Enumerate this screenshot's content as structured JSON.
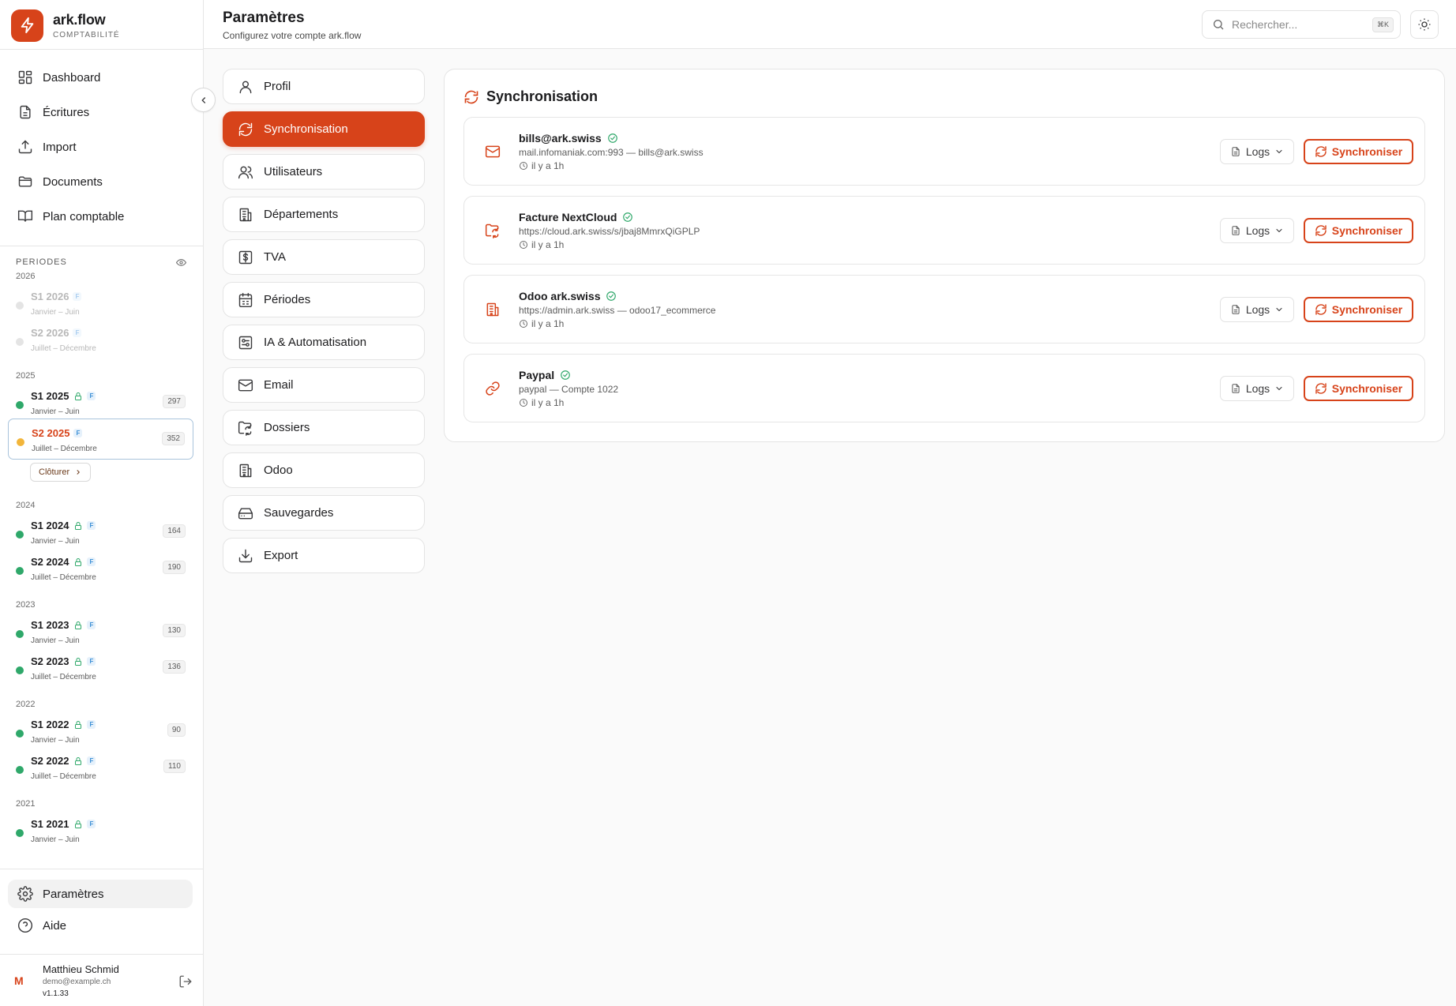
{
  "brand": {
    "name": "ark.flow",
    "subtitle": "COMPTABILITÉ"
  },
  "colors": {
    "accent": "#d7431a",
    "success": "#2fa86a",
    "warning": "#f2b53a",
    "muted": "#d6d6d6"
  },
  "nav": [
    {
      "label": "Dashboard",
      "icon": "dashboard-icon"
    },
    {
      "label": "Écritures",
      "icon": "document-icon"
    },
    {
      "label": "Import",
      "icon": "upload-icon"
    },
    {
      "label": "Documents",
      "icon": "folder-icon"
    },
    {
      "label": "Plan comptable",
      "icon": "book-icon"
    }
  ],
  "periods": {
    "title": "PERIODES",
    "groups": [
      {
        "year": "2026",
        "items": [
          {
            "name": "S1 2026",
            "tag": "F",
            "range": "Janvier – Juin",
            "status": "future",
            "locked": false,
            "count": ""
          },
          {
            "name": "S2 2026",
            "tag": "F",
            "range": "Juillet – Décembre",
            "status": "future",
            "locked": false,
            "count": ""
          }
        ]
      },
      {
        "year": "2025",
        "items": [
          {
            "name": "S1 2025",
            "tag": "F",
            "range": "Janvier – Juin",
            "status": "closed",
            "locked": true,
            "count": "297"
          },
          {
            "name": "S2 2025",
            "tag": "F",
            "range": "Juillet – Décembre",
            "status": "open",
            "locked": false,
            "count": "352",
            "selected": true
          }
        ]
      },
      {
        "year": "2024",
        "items": [
          {
            "name": "S1 2024",
            "tag": "F",
            "range": "Janvier – Juin",
            "status": "closed",
            "locked": true,
            "count": "164"
          },
          {
            "name": "S2 2024",
            "tag": "F",
            "range": "Juillet – Décembre",
            "status": "closed",
            "locked": true,
            "count": "190"
          }
        ]
      },
      {
        "year": "2023",
        "items": [
          {
            "name": "S1 2023",
            "tag": "F",
            "range": "Janvier – Juin",
            "status": "closed",
            "locked": true,
            "count": "130"
          },
          {
            "name": "S2 2023",
            "tag": "F",
            "range": "Juillet – Décembre",
            "status": "closed",
            "locked": true,
            "count": "136"
          }
        ]
      },
      {
        "year": "2022",
        "items": [
          {
            "name": "S1 2022",
            "tag": "F",
            "range": "Janvier – Juin",
            "status": "closed",
            "locked": true,
            "count": "90"
          },
          {
            "name": "S2 2022",
            "tag": "F",
            "range": "Juillet – Décembre",
            "status": "closed",
            "locked": true,
            "count": "110"
          }
        ]
      },
      {
        "year": "2021",
        "items": [
          {
            "name": "S1 2021",
            "tag": "F",
            "range": "Janvier – Juin",
            "status": "closed",
            "locked": true,
            "count": ""
          }
        ]
      }
    ],
    "close_label": "Clôturer"
  },
  "footer_nav": [
    {
      "label": "Paramètres",
      "icon": "gear-icon",
      "active": true
    },
    {
      "label": "Aide",
      "icon": "help-icon",
      "active": false
    }
  ],
  "user": {
    "initial": "M",
    "name": "Matthieu Schmid",
    "email": "demo@example.ch",
    "version": "v1.1.33"
  },
  "header": {
    "title": "Paramètres",
    "subtitle": "Configurez votre compte ark.flow",
    "search_placeholder": "Rechercher...",
    "search_shortcut": "⌘K"
  },
  "settings_menu": [
    {
      "label": "Profil",
      "icon": "user-icon"
    },
    {
      "label": "Synchronisation",
      "icon": "sync-icon",
      "active": true
    },
    {
      "label": "Utilisateurs",
      "icon": "users-icon"
    },
    {
      "label": "Départements",
      "icon": "building-icon"
    },
    {
      "label": "TVA",
      "icon": "tax-icon"
    },
    {
      "label": "Périodes",
      "icon": "calendar-icon"
    },
    {
      "label": "IA & Automatisation",
      "icon": "automation-icon"
    },
    {
      "label": "Email",
      "icon": "mail-icon"
    },
    {
      "label": "Dossiers",
      "icon": "folder-sync-icon"
    },
    {
      "label": "Odoo",
      "icon": "building-icon"
    },
    {
      "label": "Sauvegardes",
      "icon": "hard-drive-icon"
    },
    {
      "label": "Export",
      "icon": "download-icon"
    }
  ],
  "sync": {
    "title": "Synchronisation",
    "logs_label": "Logs",
    "sync_label": "Synchroniser",
    "sources": [
      {
        "name": "bills@ark.swiss",
        "detail": "mail.infomaniak.com:993 — bills@ark.swiss",
        "time": "il y a 1h",
        "icon": "mail-icon"
      },
      {
        "name": "Facture NextCloud",
        "detail": "https://cloud.ark.swiss/s/jbaj8MmrxQiGPLP",
        "time": "il y a 1h",
        "icon": "folder-sync-icon"
      },
      {
        "name": "Odoo ark.swiss",
        "detail": "https://admin.ark.swiss — odoo17_ecommerce",
        "time": "il y a 1h",
        "icon": "building-icon"
      },
      {
        "name": "Paypal",
        "detail": "paypal — Compte 1022",
        "time": "il y a 1h",
        "icon": "link-icon"
      }
    ]
  }
}
